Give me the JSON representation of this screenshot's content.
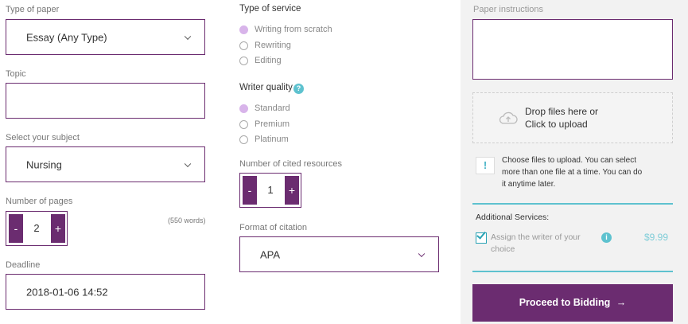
{
  "paper_type": {
    "label": "Type of paper",
    "value": "Essay (Any Type)"
  },
  "topic": {
    "label": "Topic",
    "value": ""
  },
  "subject": {
    "label": "Select your subject",
    "value": "Nursing"
  },
  "pages": {
    "label": "Number of pages",
    "minus": "-",
    "plus": "+",
    "value": "2",
    "words": "(550 words)"
  },
  "deadline": {
    "label": "Deadline",
    "value": "2018-01-06 14:52"
  },
  "service": {
    "label": "Type of service",
    "options": [
      {
        "label": "Writing from scratch",
        "selected": true
      },
      {
        "label": "Rewriting",
        "selected": false
      },
      {
        "label": "Editing",
        "selected": false
      }
    ]
  },
  "writer_quality": {
    "label": "Writer quality",
    "help": "?",
    "options": [
      {
        "label": "Standard",
        "selected": true
      },
      {
        "label": "Premium",
        "selected": false
      },
      {
        "label": "Platinum",
        "selected": false
      }
    ]
  },
  "cited": {
    "label": "Number of cited resources",
    "minus": "-",
    "plus": "+",
    "value": "1"
  },
  "citation": {
    "label": "Format of citation",
    "value": "APA"
  },
  "instructions": {
    "label": "Paper instructions",
    "value": ""
  },
  "upload": {
    "line1": "Drop files here or",
    "line2": "Click to upload",
    "note_icon": "!",
    "note_line1": "Choose files to upload. You can select",
    "note_line2": "more than one file at a time. You can do",
    "note_line3": "it anytime later."
  },
  "additional": {
    "title": "Additional Services:",
    "checked": true,
    "item_line1": "Assign the writer of your",
    "item_line2": "choice",
    "info": "i",
    "price": "$9.99"
  },
  "proceed_label": "Proceed to Bidding",
  "proceed_arrow": "→",
  "colors": {
    "primary": "#6b2c70",
    "accent": "#5ec2cf",
    "radio_selected": "#d8b4ea",
    "panel": "#f2f2f2"
  }
}
